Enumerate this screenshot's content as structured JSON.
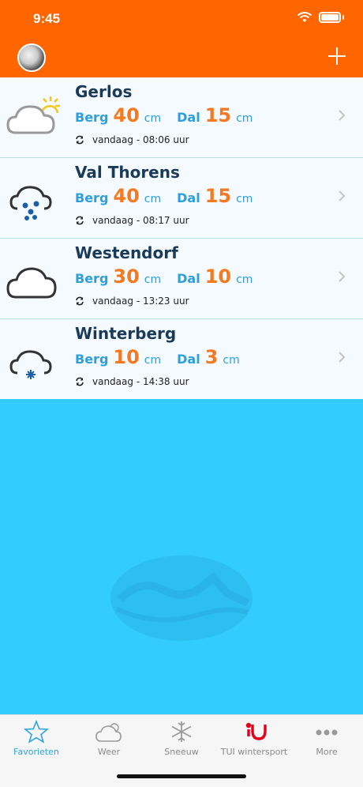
{
  "status_bar": {
    "time": "9:45"
  },
  "resorts": [
    {
      "name": "Gerlos",
      "icon": "cloud-sun-icon",
      "berg_label": "Berg",
      "berg_value": "40",
      "dal_label": "Dal",
      "dal_value": "15",
      "unit": "cm",
      "updated": "vandaag - 08:06 uur"
    },
    {
      "name": "Val Thorens",
      "icon": "cloud-snow-heavy-icon",
      "berg_label": "Berg",
      "berg_value": "40",
      "dal_label": "Dal",
      "dal_value": "15",
      "unit": "cm",
      "updated": "vandaag - 08:17 uur"
    },
    {
      "name": "Westendorf",
      "icon": "cloud-icon",
      "berg_label": "Berg",
      "berg_value": "30",
      "dal_label": "Dal",
      "dal_value": "10",
      "unit": "cm",
      "updated": "vandaag - 13:23 uur"
    },
    {
      "name": "Winterberg",
      "icon": "cloud-snow-light-icon",
      "berg_label": "Berg",
      "berg_value": "10",
      "dal_label": "Dal",
      "dal_value": "3",
      "unit": "cm",
      "updated": "vandaag - 14:38 uur"
    }
  ],
  "tabs": [
    {
      "label": "Favorieten",
      "icon": "star-icon",
      "active": true
    },
    {
      "label": "Weer",
      "icon": "cloud-sun-icon",
      "active": false
    },
    {
      "label": "Sneeuw",
      "icon": "snowflake-icon",
      "active": false
    },
    {
      "label": "TUI wintersport",
      "icon": "tui-logo-icon",
      "active": false
    },
    {
      "label": "More",
      "icon": "more-dots-icon",
      "active": false
    }
  ],
  "colors": {
    "header": "#ff6600",
    "background": "#33ccff",
    "accent": "#2aa3e0",
    "value": "#f47920"
  }
}
